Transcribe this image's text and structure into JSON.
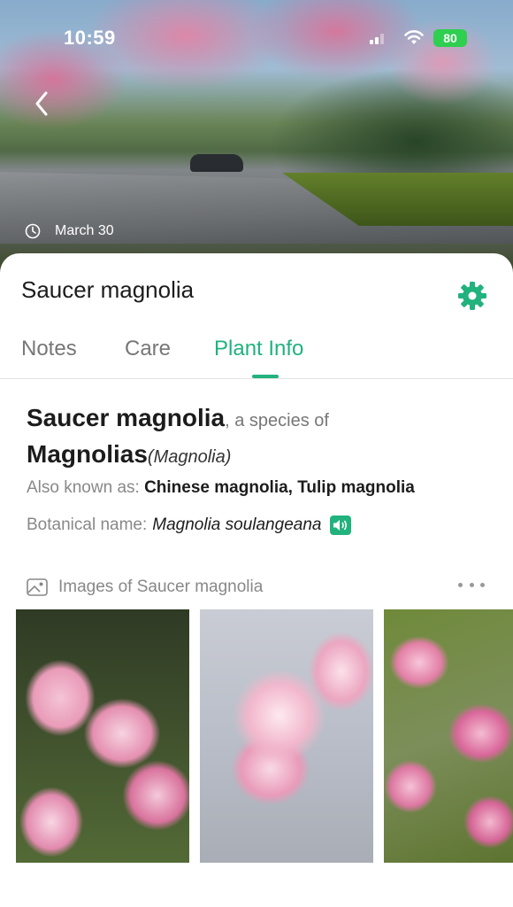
{
  "status_bar": {
    "time": "10:59",
    "battery": "80"
  },
  "hero": {
    "date": "March 30"
  },
  "sheet": {
    "title": "Saucer magnolia",
    "tabs": [
      {
        "label": "Notes",
        "active": false
      },
      {
        "label": "Care",
        "active": false
      },
      {
        "label": "Plant Info",
        "active": true
      }
    ]
  },
  "plant_info": {
    "common_name": "Saucer magnolia",
    "species_connector": ", a species of",
    "genus": "Magnolias",
    "genus_latin": "(Magnolia)",
    "aka_label": "Also known as:",
    "aka_value": "Chinese magnolia, Tulip magnolia",
    "botanical_label": "Botanical name:",
    "botanical_value": "Magnolia soulangeana"
  },
  "images_section": {
    "title": "Images of Saucer magnolia",
    "thumbnails": [
      "magnolia-photo-1",
      "magnolia-photo-2",
      "magnolia-photo-3"
    ]
  },
  "colors": {
    "accent": "#21b27e",
    "battery": "#2fcf4f"
  },
  "icons": [
    "chevron-left-icon",
    "clock-icon",
    "gear-icon",
    "speaker-icon",
    "image-icon",
    "more-icon"
  ]
}
